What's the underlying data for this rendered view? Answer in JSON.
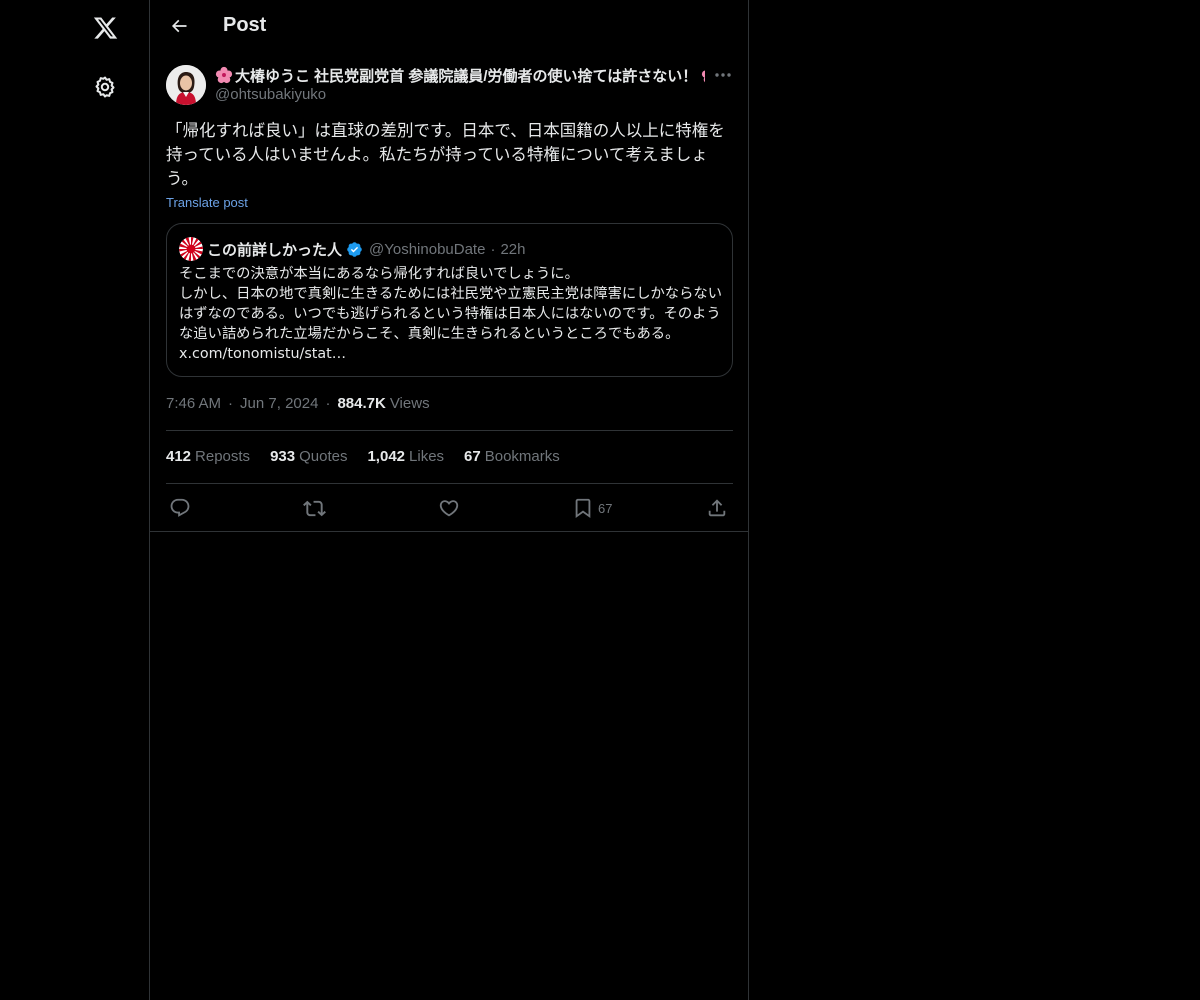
{
  "header": {
    "title": "Post"
  },
  "post": {
    "author_name": "大椿ゆうこ 社民党副党首 参議院議員/労働者の使い捨ては許さない！",
    "author_handle": "@ohtsubakiyuko",
    "text": "「帰化すれば良い」は直球の差別です。日本で、日本国籍の人以上に特権を持っている人はいませんよ。私たちが持っている特権について考えましょう。",
    "translate_label": "Translate post",
    "time": "7:46 AM",
    "date": "Jun 7, 2024",
    "views_count": "884.7K",
    "views_label": "Views"
  },
  "quote": {
    "name": "この前詳しかった人",
    "handle": "@YoshinobuDate",
    "time": "22h",
    "text": "そこまでの決意が本当にあるなら帰化すれば良いでしょうに。\nしかし、日本の地で真剣に生きるためには社民党や立憲民主党は障害にしかならないはずなのである。いつでも逃げられるという特権は日本人にはないのです。そのような追い詰められた立場だからこそ、真剣に生きられるというところでもある。 x.com/tonomistu/stat…"
  },
  "stats": {
    "reposts_count": "412",
    "reposts_label": "Reposts",
    "quotes_count": "933",
    "quotes_label": "Quotes",
    "likes_count": "1,042",
    "likes_label": "Likes",
    "bookmarks_count": "67",
    "bookmarks_label": "Bookmarks"
  },
  "actions": {
    "bookmark_count": "67"
  },
  "icons": {
    "logo": "x-logo-icon",
    "settings": "gear-icon",
    "back": "arrow-left-icon",
    "more": "more-horizontal-icon",
    "reply": "reply-icon",
    "repost": "repost-icon",
    "like": "heart-icon",
    "bookmark": "bookmark-icon",
    "share": "share-icon",
    "verified": "verified-badge-icon"
  },
  "colors": {
    "background": "#000000",
    "text": "#e7e9ea",
    "muted": "#71767b",
    "link": "#6ca2e6",
    "border": "#2f3336",
    "verified": "#1d9bf0"
  }
}
